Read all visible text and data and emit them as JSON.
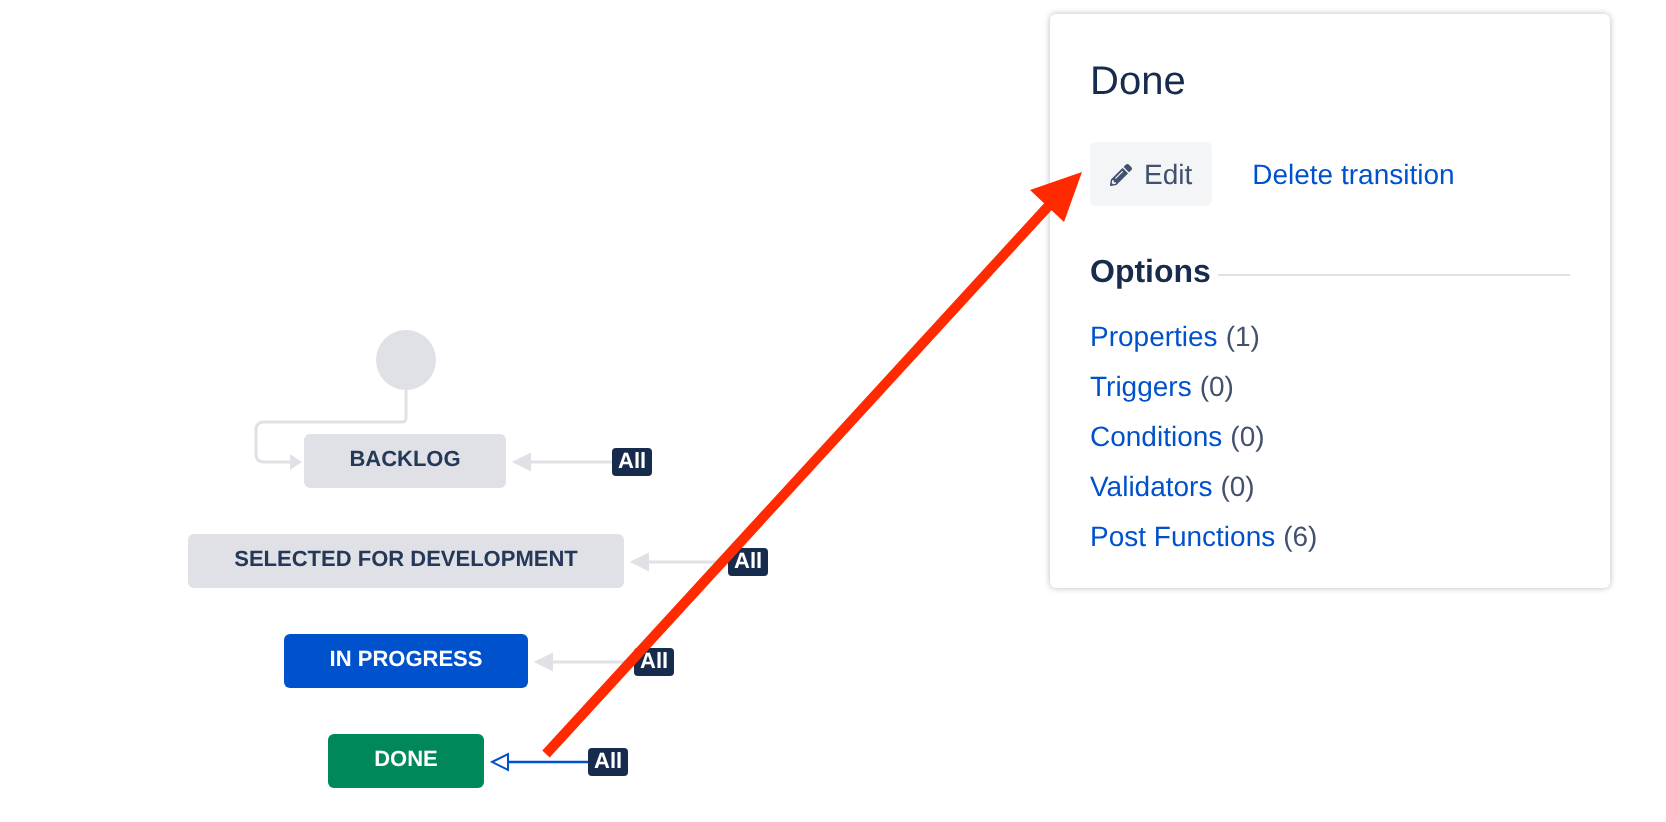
{
  "diagram": {
    "statuses": [
      {
        "name": "BACKLOG",
        "kind": "todo",
        "transition": {
          "label": "All",
          "selected": false
        }
      },
      {
        "name": "SELECTED FOR DEVELOPMENT",
        "kind": "todo",
        "transition": {
          "label": "All",
          "selected": false
        }
      },
      {
        "name": "IN PROGRESS",
        "kind": "in_progress",
        "transition": {
          "label": "All",
          "selected": false
        }
      },
      {
        "name": "DONE",
        "kind": "done",
        "transition": {
          "label": "All",
          "selected": true
        }
      }
    ]
  },
  "panel": {
    "title": "Done",
    "edit_button": "Edit",
    "delete_link": "Delete transition",
    "options_heading": "Options",
    "options": [
      {
        "label": "Properties",
        "count": "(1)"
      },
      {
        "label": "Triggers",
        "count": "(0)"
      },
      {
        "label": "Conditions",
        "count": "(0)"
      },
      {
        "label": "Validators",
        "count": "(0)"
      },
      {
        "label": "Post Functions",
        "count": "(6)"
      }
    ]
  }
}
